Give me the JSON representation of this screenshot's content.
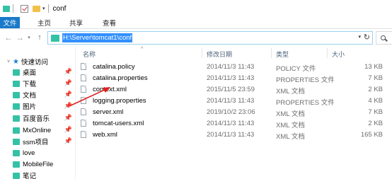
{
  "window": {
    "title": "conf"
  },
  "ribbon": {
    "tabs": [
      "文件",
      "主页",
      "共享",
      "查看"
    ]
  },
  "address": {
    "path": "H:\\Server\\tomcat1\\conf"
  },
  "nav_pane": {
    "quick_access_label": "快速访问",
    "items": [
      {
        "label": "桌面",
        "pinned": true
      },
      {
        "label": "下载",
        "pinned": true
      },
      {
        "label": "文档",
        "pinned": true
      },
      {
        "label": "图片",
        "pinned": true
      },
      {
        "label": "百度音乐",
        "pinned": true
      },
      {
        "label": "MxOnline",
        "pinned": true
      },
      {
        "label": "ssm项目",
        "pinned": true
      },
      {
        "label": "love",
        "pinned": false
      },
      {
        "label": "MobileFile",
        "pinned": false
      },
      {
        "label": "笔记",
        "pinned": false
      }
    ]
  },
  "columns": {
    "name": "名称",
    "date": "修改日期",
    "type": "类型",
    "size": "大小"
  },
  "files": [
    {
      "name": "catalina.policy",
      "date": "2014/11/3 11:43",
      "type": "POLICY 文件",
      "size": "13 KB"
    },
    {
      "name": "catalina.properties",
      "date": "2014/11/3 11:43",
      "type": "PROPERTIES 文件",
      "size": "7 KB"
    },
    {
      "name": "context.xml",
      "date": "2015/11/5 23:59",
      "type": "XML 文档",
      "size": "2 KB"
    },
    {
      "name": "logging.properties",
      "date": "2014/11/3 11:43",
      "type": "PROPERTIES 文件",
      "size": "4 KB"
    },
    {
      "name": "server.xml",
      "date": "2019/10/2 23:06",
      "type": "XML 文档",
      "size": "7 KB"
    },
    {
      "name": "tomcat-users.xml",
      "date": "2014/11/3 11:43",
      "type": "XML 文档",
      "size": "2 KB"
    },
    {
      "name": "web.xml",
      "date": "2014/11/3 11:43",
      "type": "XML 文档",
      "size": "165 KB"
    }
  ],
  "colors": {
    "accent": "#1979ca",
    "folder": "#34c2a6",
    "selection": "#3390ff",
    "annotation_arrow": "#e02020"
  }
}
